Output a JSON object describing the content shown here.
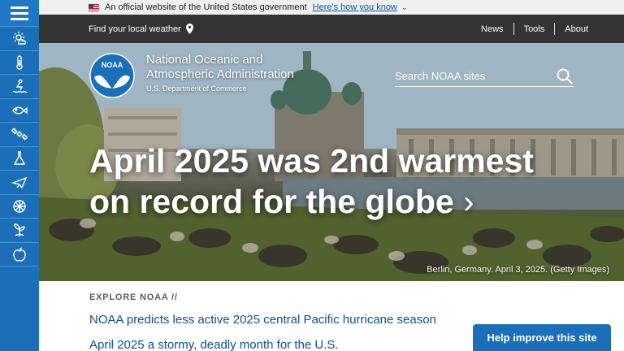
{
  "gov_banner": {
    "text": "An official website of the United States government",
    "link": "Here's how you know"
  },
  "topbar": {
    "find_weather": "Find your local weather",
    "links": [
      "News",
      "Tools",
      "About"
    ]
  },
  "logo": {
    "badge": "NOAA",
    "org_line1": "National Oceanic and",
    "org_line2": "Atmospheric Administration",
    "department": "U.S. Department of Commerce"
  },
  "search": {
    "placeholder": "Search NOAA sites"
  },
  "hero": {
    "title": "April 2025 was 2nd warmest on record for the globe",
    "arrow": "›",
    "caption": "Berlin, Germany. April 3, 2025. (Getty Images)"
  },
  "rail": {
    "icons": [
      "weather-icon",
      "climate-icon",
      "ocean-coasts-icon",
      "fisheries-icon",
      "satellites-icon",
      "research-icon",
      "marine-aviation-icon",
      "charting-icon",
      "sanctuaries-icon",
      "education-icon"
    ]
  },
  "explore": {
    "label": "EXPLORE NOAA //",
    "items": [
      "NOAA predicts less active 2025 central Pacific hurricane season",
      "April 2025 a stormy, deadly month for the U.S."
    ]
  },
  "help_button": "Help improve this site",
  "colors": {
    "rail": "#1a6fb8",
    "topbar": "#333333",
    "link": "#0b4f91"
  }
}
